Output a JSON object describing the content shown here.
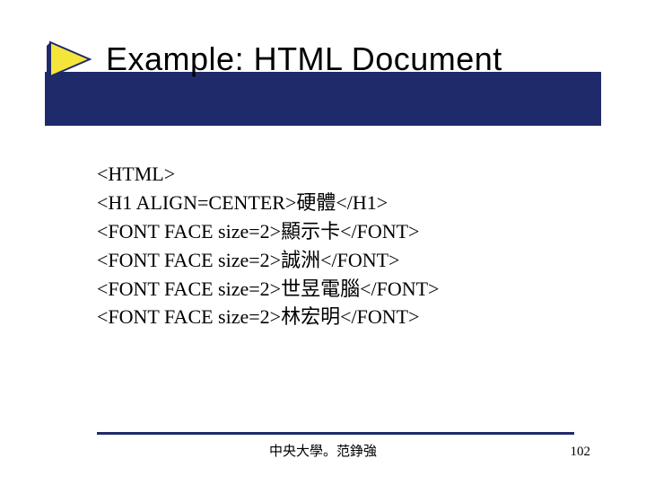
{
  "title": "Example: HTML Document",
  "icon": "triangle-bullet-icon",
  "code_lines": [
    "<HTML>",
    "<H1 ALIGN=CENTER>硬體</H1>",
    "<FONT FACE size=2>顯示卡</FONT>",
    "<FONT FACE size=2>誠洲</FONT>",
    "<FONT FACE size=2>世昱電腦</FONT>",
    "<FONT FACE size=2>林宏明</FONT>"
  ],
  "footer": {
    "center": "中央大學。范錚強",
    "page_number": "102"
  },
  "colors": {
    "bar": "#1f2a6a",
    "triangle_fill": "#f5e43a",
    "triangle_stroke": "#1f2a6a"
  }
}
